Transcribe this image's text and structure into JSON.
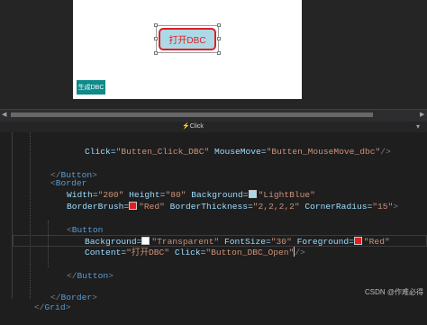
{
  "designer": {
    "rounded_button_label": "打开DBC",
    "generate_button_label": "生成DBC"
  },
  "splitter": {
    "pane_label": "Click"
  },
  "code": {
    "l1": {
      "attr": "Click=",
      "val": "\"Butten_Click_DBC\"",
      "attr2": " MouseMove=",
      "val2": "\"Butten_MouseMove_dbc\"",
      "end": "/>"
    },
    "l2": {
      "open": "</",
      "name": "Button",
      "close": ">"
    },
    "l3": {
      "open": "<",
      "name": "Border"
    },
    "l4": {
      "a1": "Width=",
      "v1": "\"200\"",
      "a2": " Height=",
      "v2": "\"80\"",
      "a3": " Background=",
      "v3": "\"LightBlue\""
    },
    "l5": {
      "a1": "BorderBrush=",
      "v1": "\"Red\"",
      "a2": " BorderThickness=",
      "v2": "\"2,2,2,2\"",
      "a3": " CornerRadius=",
      "v3": "\"15\"",
      "end": ">"
    },
    "l6": {
      "open": "<",
      "name": "Button"
    },
    "l7": {
      "a1": "Background=",
      "v1": "\"Transparent\"",
      "a2": " FontSize=",
      "v2": "\"30\"",
      "a3": " Foreground=",
      "v3": "\"Red\""
    },
    "l8": {
      "a1": "Content=",
      "v1": "\"打开DBC\"",
      "a2": " Click=",
      "v2": "\"Button_DBC_Open\"",
      "end": "/>"
    },
    "l9": {
      "open": "</",
      "name": "Button",
      "close": ">"
    },
    "l10": {
      "open": "</",
      "name": "Border",
      "close": ">"
    },
    "l11": {
      "open": "</",
      "name": "Grid",
      "close": ">"
    }
  },
  "watermark": "CSDN @作难必得",
  "colors": {
    "lightblue_swatch": "#add8e6",
    "red_swatch": "#e02020",
    "transparent_swatch": "#ffffff"
  }
}
